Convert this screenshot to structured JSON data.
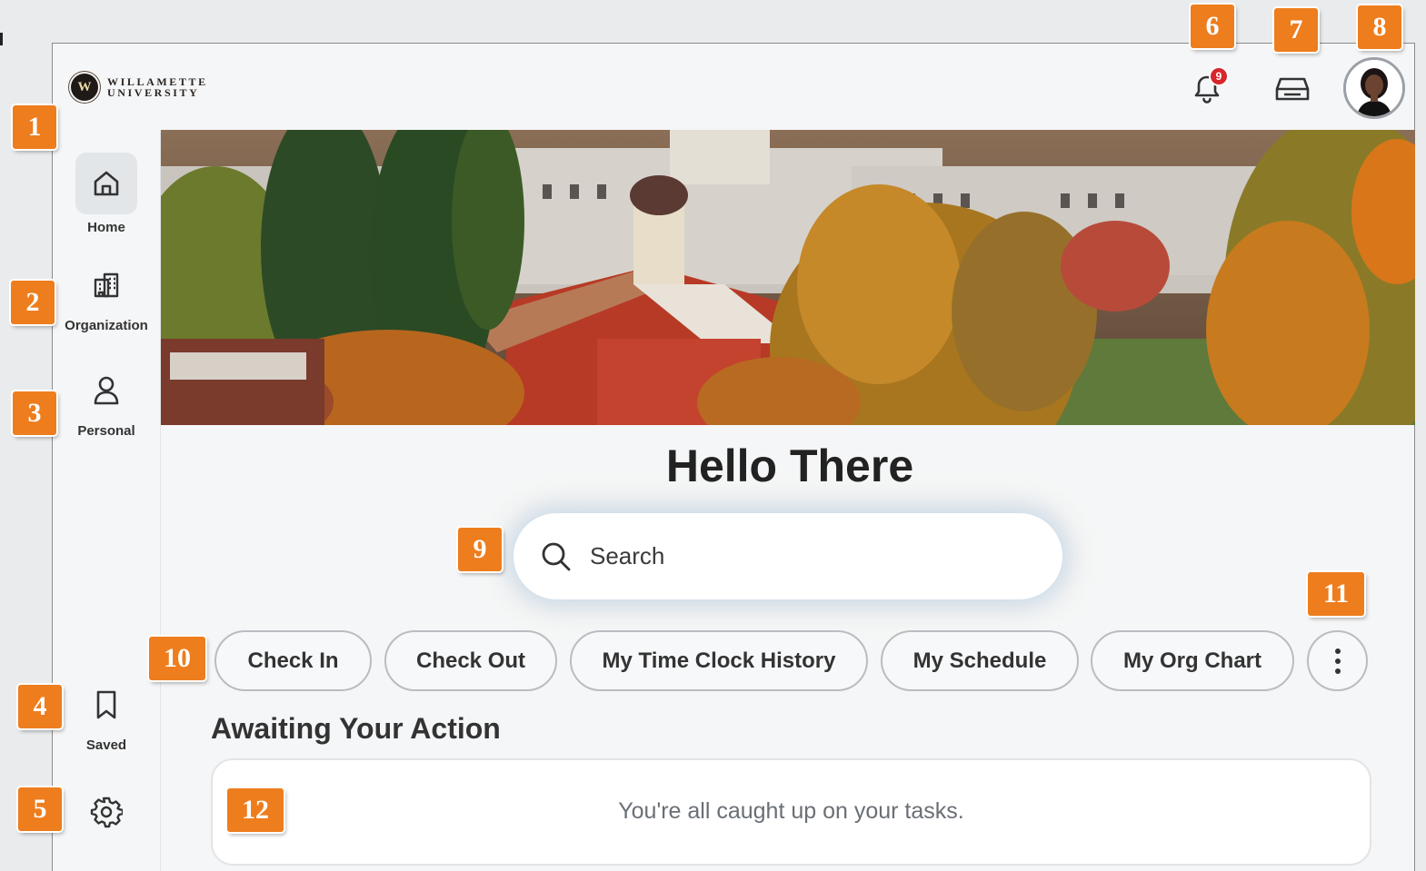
{
  "brand": {
    "name_line1": "WILLAMETTE",
    "name_line2": "UNIVERSITY",
    "seal_letter": "W"
  },
  "header": {
    "notifications": {
      "icon": "bell-icon",
      "count": "9",
      "badge_color": "#d7262c"
    },
    "inbox": {
      "icon": "inbox-icon"
    },
    "profile": {
      "icon": "avatar"
    }
  },
  "sidebar": {
    "items": [
      {
        "label": "Home",
        "icon": "home-icon",
        "active": true
      },
      {
        "label": "Organization",
        "icon": "building-icon"
      },
      {
        "label": "Personal",
        "icon": "person-icon"
      },
      {
        "label": "Saved",
        "icon": "bookmark-icon"
      },
      {
        "label": "",
        "icon": "gear-icon"
      }
    ]
  },
  "main": {
    "greeting": "Hello There",
    "search": {
      "placeholder": "Search"
    },
    "quick_actions": [
      "Check In",
      "Check Out",
      "My Time Clock History",
      "My Schedule",
      "My Org Chart"
    ],
    "more_icon": "more-vertical-icon",
    "awaiting": {
      "title": "Awaiting Your Action",
      "message": "You're all caught up on your tasks."
    }
  },
  "markers": [
    "1",
    "2",
    "3",
    "4",
    "5",
    "6",
    "7",
    "8",
    "9",
    "10",
    "11",
    "12"
  ],
  "colors": {
    "marker": "#ee7d1d",
    "badge": "#d7262c",
    "background": "#f5f6f7"
  }
}
